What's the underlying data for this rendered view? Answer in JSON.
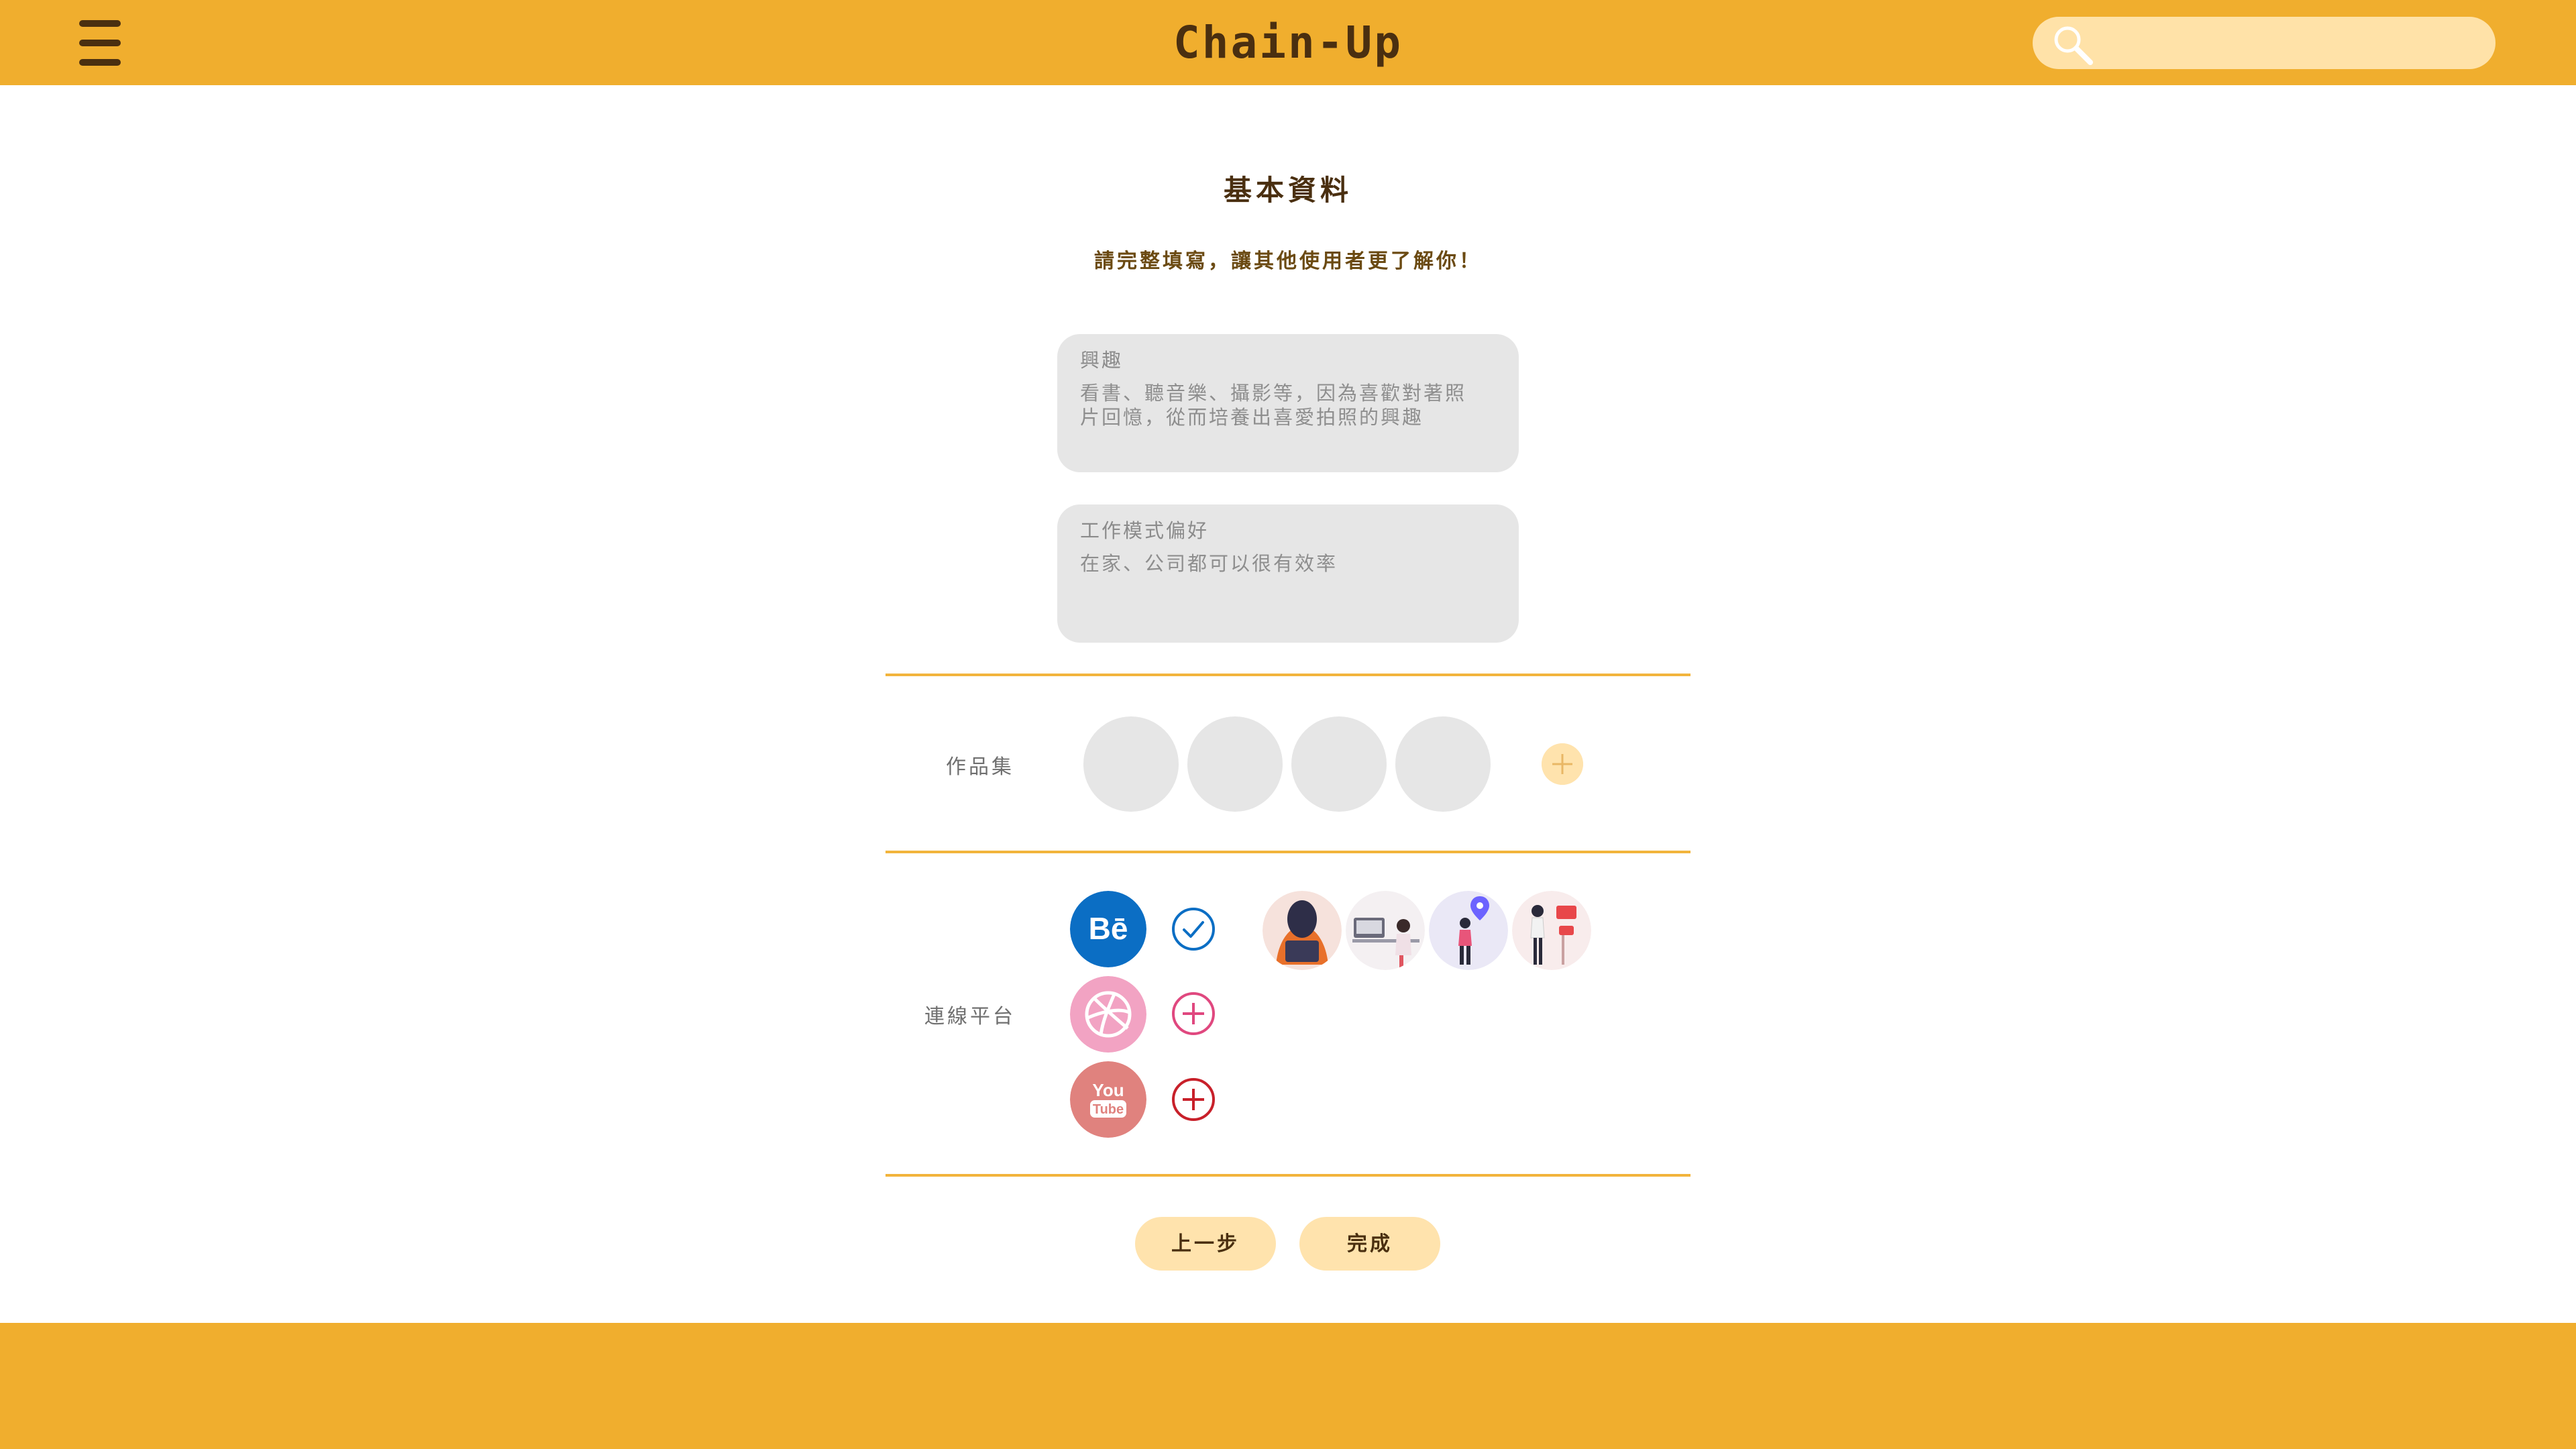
{
  "header": {
    "menu_icon": "hamburger-menu-icon",
    "brand": "Chain-Up",
    "search": {
      "icon": "search-icon",
      "placeholder": "",
      "value": ""
    }
  },
  "page": {
    "title": "基本資料",
    "subtitle": "請完整填寫，讓其他使用者更了解你！"
  },
  "fields": [
    {
      "label": "興趣",
      "value_lines": [
        "看書、聽音樂、攝影等，因為喜歡對著照",
        "片回憶，從而培養出喜愛拍照的興趣"
      ]
    },
    {
      "label": "工作模式偏好",
      "value_lines": [
        "在家、公司都可以很有效率"
      ]
    }
  ],
  "portfolio": {
    "label": "作品集",
    "thumbnail_count": 4,
    "add_icon": "plus-icon"
  },
  "platforms": {
    "label": "連線平台",
    "items": [
      {
        "name": "Behance",
        "logo_text": "Bē",
        "status": "connected",
        "status_icon": "check-circle-icon",
        "color": "#1769FF"
      },
      {
        "name": "Dribbble",
        "status": "add",
        "status_icon": "plus-circle-icon",
        "color": "#EA4C89"
      },
      {
        "name": "YouTube",
        "logo_text": [
          "You",
          "Tube"
        ],
        "status": "add",
        "status_icon": "plus-circle-icon",
        "color": "#E0827E"
      }
    ],
    "avatars": [
      "avatar-person-laptop",
      "avatar-person-desk",
      "avatar-person-location",
      "avatar-person-presenting"
    ]
  },
  "buttons": {
    "back": "上一步",
    "done": "完成"
  },
  "colors": {
    "primary": "#F0AE2E",
    "accent_light": "#FFE3AD",
    "card_bg": "#E6E6E6",
    "text_dark": "#4a2f10"
  }
}
